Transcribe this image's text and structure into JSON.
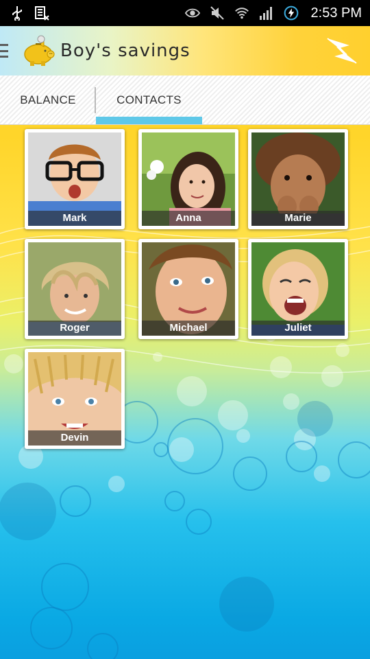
{
  "status_bar": {
    "time": "2:53 PM",
    "icons": [
      "usb-icon",
      "barcode-icon",
      "eye-icon",
      "mute-icon",
      "wifi-icon",
      "signal-icon",
      "battery-charging-icon"
    ]
  },
  "app_bar": {
    "title": "Boy's savings",
    "logo": "piggy-bank-icon",
    "menu_icon": "menu-icon",
    "action_icon": "transfer-arrows-icon"
  },
  "tabs": [
    {
      "label": "BALANCE",
      "selected": false
    },
    {
      "label": "CONTACTS",
      "selected": true
    }
  ],
  "colors": {
    "tab_indicator": "#5fc8e8",
    "status_bar": "#000000",
    "name_band": "#282828"
  },
  "contacts": [
    {
      "name": "Mark"
    },
    {
      "name": "Anna"
    },
    {
      "name": "Marie"
    },
    {
      "name": "Roger"
    },
    {
      "name": "Michael"
    },
    {
      "name": "Juliet"
    },
    {
      "name": "Devin"
    }
  ]
}
